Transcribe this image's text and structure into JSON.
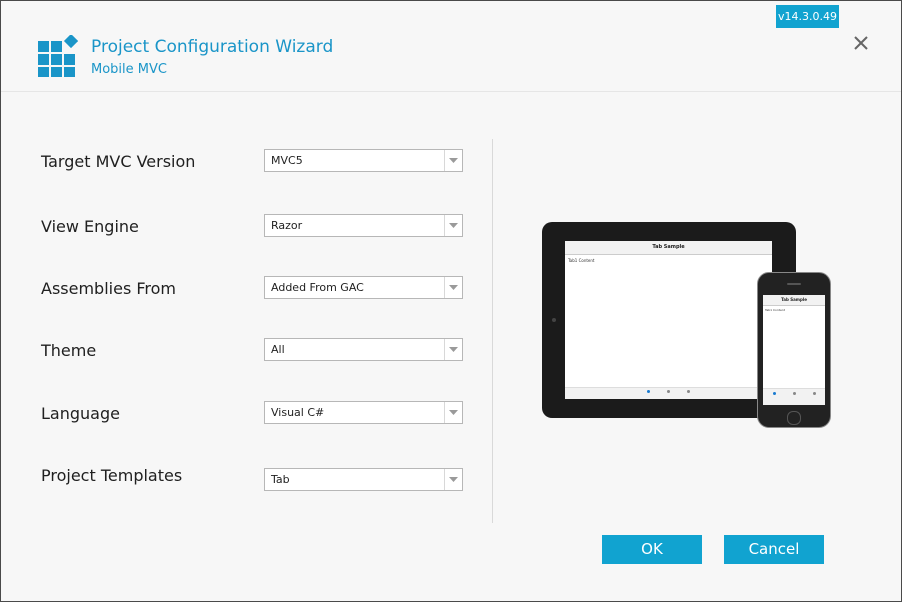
{
  "header": {
    "title": "Project Configuration Wizard",
    "subtitle": "Mobile MVC",
    "version": "v14.3.0.49",
    "accent": "#1a95c8",
    "badge_color": "#11a3d0"
  },
  "fields": [
    {
      "label": "Target MVC Version",
      "value": "MVC5"
    },
    {
      "label": "View Engine",
      "value": "Razor"
    },
    {
      "label": "Assemblies From",
      "value": "Added From GAC"
    },
    {
      "label": "Theme",
      "value": "All"
    },
    {
      "label": "Language",
      "value": "Visual C#"
    },
    {
      "label": "Project Templates",
      "value": "Tab"
    }
  ],
  "preview": {
    "tablet_title": "Tab Sample",
    "tablet_content": "Tab1 Content",
    "phone_title": "Tab Sample",
    "phone_content": "Tab1 Content"
  },
  "buttons": {
    "ok": "OK",
    "cancel": "Cancel"
  }
}
